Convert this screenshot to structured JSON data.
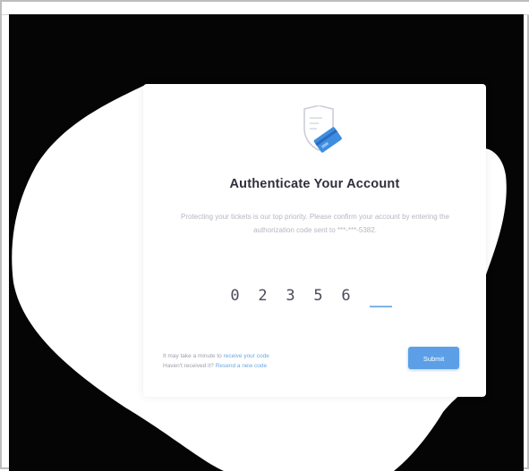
{
  "card": {
    "title": "Authenticate Your Account",
    "description": "Protecting your tickets is our top priority. Please confirm your account by entering the authorization code sent to ***-***-5382.",
    "code_digits": [
      "0",
      "2",
      "3",
      "5",
      "6"
    ],
    "footer": {
      "line1_prefix": "It may take a minute to ",
      "line1_link": "receive your code",
      "line2_prefix": "Haven't received it? ",
      "line2_link": "Resend a new code"
    },
    "submit_label": "Submit"
  },
  "colors": {
    "accent": "#5c9fe6",
    "background": "#050505",
    "title": "#2f2f3d"
  },
  "icons": {
    "hero": "shield-card-icon"
  }
}
